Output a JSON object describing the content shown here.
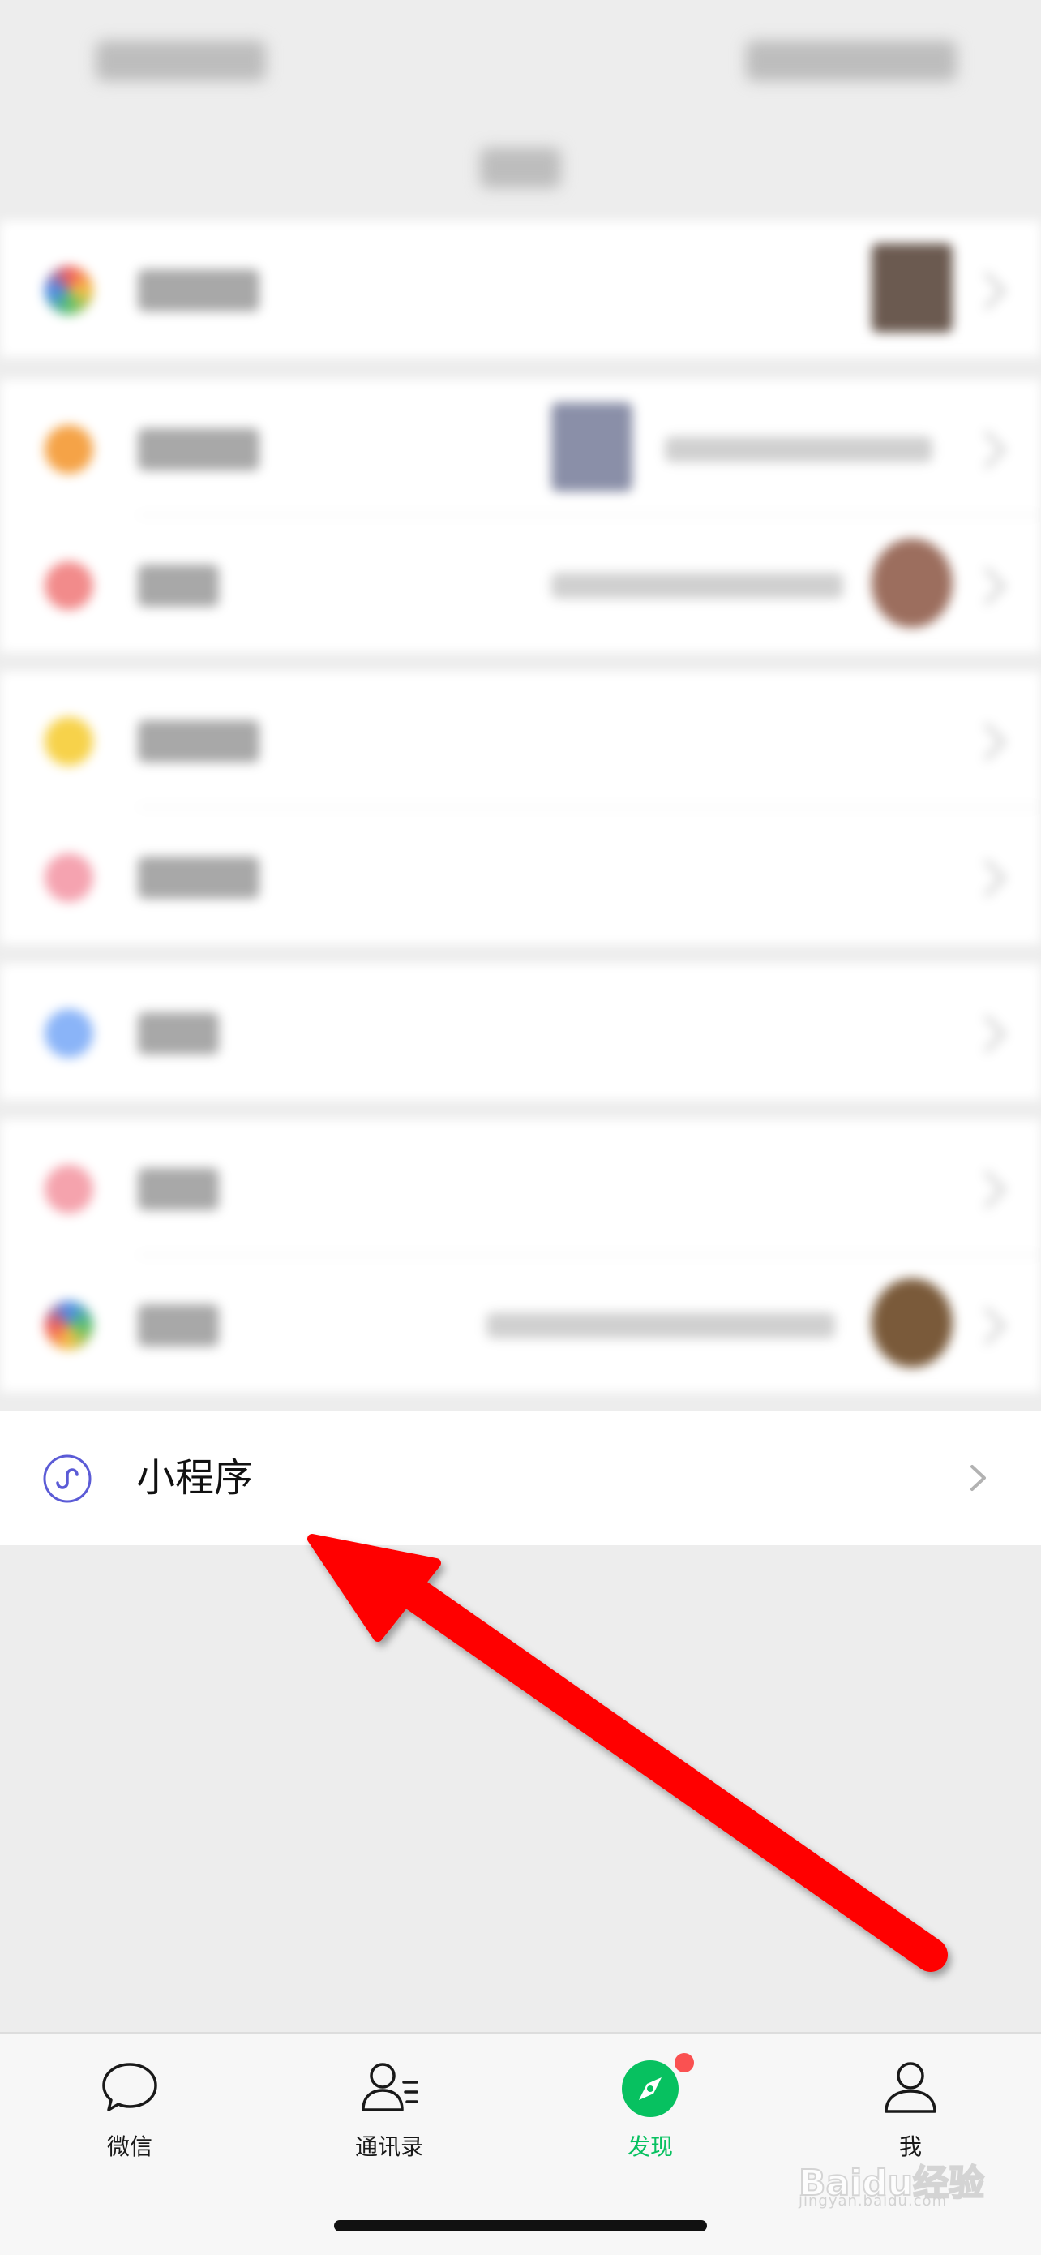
{
  "mini_programs": {
    "label": "小程序",
    "icon": "mini-program-icon"
  },
  "tabbar": {
    "items": [
      {
        "label": "微信",
        "icon": "chat-bubble-icon"
      },
      {
        "label": "通讯录",
        "icon": "contacts-icon"
      },
      {
        "label": "发现",
        "icon": "compass-icon",
        "active": true,
        "badge_dot": true
      },
      {
        "label": "我",
        "icon": "person-icon"
      }
    ],
    "active_color": "#07c160",
    "badge_color": "#fa5151"
  },
  "annotation": {
    "type": "red-arrow",
    "color": "#ff0000"
  },
  "watermark": {
    "logo": "Baidu经验",
    "sub": "jingyan.baidu.com"
  },
  "colors": {
    "background": "#ededed",
    "row": "#ffffff",
    "mini_program_icon": "#5b5bd6"
  }
}
